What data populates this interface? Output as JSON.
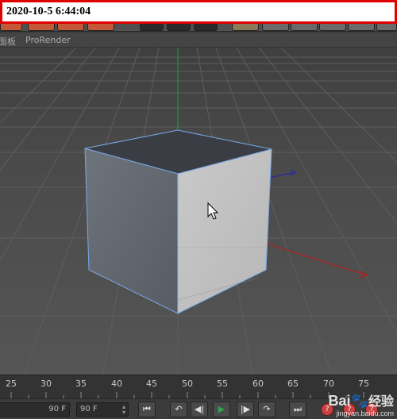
{
  "timestamp": "2020-10-5 6:44:04",
  "menu": {
    "items": [
      {
        "label": "面板"
      },
      {
        "label": "ProRender"
      }
    ]
  },
  "timeline": {
    "ticks": [
      "25",
      "30",
      "35",
      "40",
      "45",
      "50",
      "55",
      "60",
      "65",
      "70",
      "75"
    ]
  },
  "transport": {
    "current_frame": "90 F",
    "end_frame": "90 F"
  },
  "colors": {
    "axis_x": "#b02020",
    "axis_y": "#1a9a2a",
    "axis_z": "#2a2aa0",
    "selection_outline": "#7aa8e6",
    "play_green": "#2aa84a"
  },
  "icons": {
    "go_start": "go-to-start-icon",
    "prev_key": "previous-keyframe-icon",
    "step_back": "step-back-icon",
    "play": "play-icon",
    "step_forward": "step-forward-icon",
    "next_key": "next-keyframe-icon",
    "go_end": "go-to-end-icon"
  },
  "watermark": {
    "brand": "Bai",
    "brand2": "经验",
    "url": "jingyan.baidu.com"
  }
}
